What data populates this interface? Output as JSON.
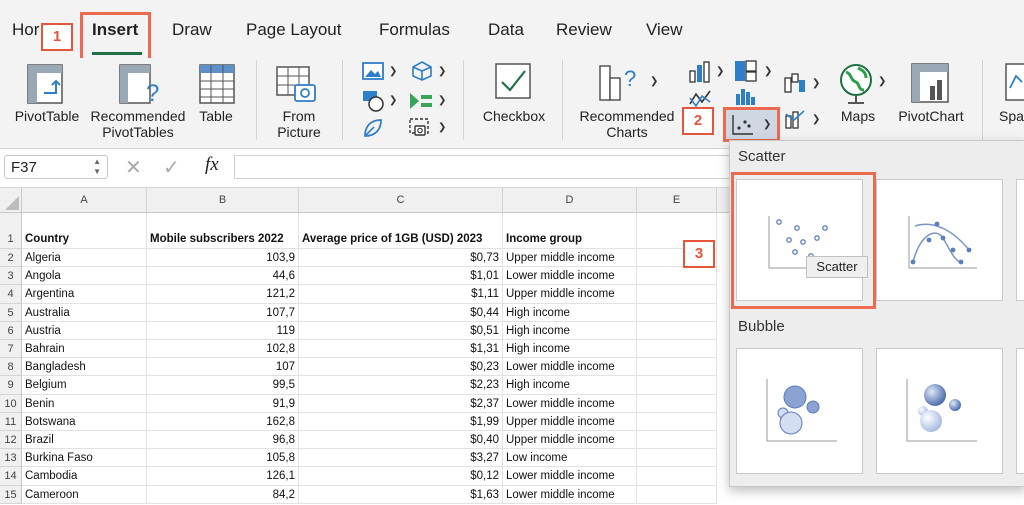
{
  "tabs": [
    {
      "label": "Hor",
      "active": false
    },
    {
      "label": "Insert",
      "active": true
    },
    {
      "label": "Draw",
      "active": false
    },
    {
      "label": "Page Layout",
      "active": false
    },
    {
      "label": "Formulas",
      "active": false
    },
    {
      "label": "Data",
      "active": false
    },
    {
      "label": "Review",
      "active": false
    },
    {
      "label": "View",
      "active": false
    }
  ],
  "ribbon": {
    "pivottable": "PivotTable",
    "recommended_pivottables_1": "Recommended",
    "recommended_pivottables_2": "PivotTables",
    "table": "Table",
    "from_picture_1": "From",
    "from_picture_2": "Picture",
    "checkbox": "Checkbox",
    "recommended_charts_1": "Recommended",
    "recommended_charts_2": "Charts",
    "maps": "Maps",
    "pivotchart": "PivotChart",
    "sparklines_partial": "Spa"
  },
  "formula_bar": {
    "name_box": "F37",
    "fx": "fx",
    "value": ""
  },
  "columns": [
    "A",
    "B",
    "C",
    "D",
    "E"
  ],
  "rows": [
    {
      "n": "1",
      "a": "Country",
      "b": "Mobile subscribers 2022",
      "c": "Average price of 1GB (USD) 2023",
      "d": "Income group"
    },
    {
      "n": "2",
      "a": "Algeria",
      "b": "103,9",
      "c": "$0,73",
      "d": "Upper middle income"
    },
    {
      "n": "3",
      "a": "Angola",
      "b": "44,6",
      "c": "$1,01",
      "d": "Lower middle income"
    },
    {
      "n": "4",
      "a": "Argentina",
      "b": "121,2",
      "c": "$1,11",
      "d": "Upper middle income"
    },
    {
      "n": "5",
      "a": "Australia",
      "b": "107,7",
      "c": "$0,44",
      "d": "High income"
    },
    {
      "n": "6",
      "a": "Austria",
      "b": "119",
      "c": "$0,51",
      "d": "High income"
    },
    {
      "n": "7",
      "a": "Bahrain",
      "b": "102,8",
      "c": "$1,31",
      "d": "High income"
    },
    {
      "n": "8",
      "a": "Bangladesh",
      "b": "107",
      "c": "$0,23",
      "d": "Lower middle income"
    },
    {
      "n": "9",
      "a": "Belgium",
      "b": "99,5",
      "c": "$2,23",
      "d": "High income"
    },
    {
      "n": "10",
      "a": "Benin",
      "b": "91,9",
      "c": "$2,37",
      "d": "Lower middle income"
    },
    {
      "n": "11",
      "a": "Botswana",
      "b": "162,8",
      "c": "$1,99",
      "d": "Upper middle income"
    },
    {
      "n": "12",
      "a": "Brazil",
      "b": "96,8",
      "c": "$0,40",
      "d": "Upper middle income"
    },
    {
      "n": "13",
      "a": "Burkina Faso",
      "b": "105,8",
      "c": "$3,27",
      "d": "Low income"
    },
    {
      "n": "14",
      "a": "Cambodia",
      "b": "126,1",
      "c": "$0,12",
      "d": "Lower middle income"
    },
    {
      "n": "15",
      "a": "Cameroon",
      "b": "84,2",
      "c": "$1,63",
      "d": "Lower middle income"
    }
  ],
  "panel": {
    "scatter_title": "Scatter",
    "bubble_title": "Bubble",
    "tooltip": "Scatter"
  },
  "callouts": [
    "1",
    "2",
    "3"
  ],
  "colors": {
    "accent": "#1e7145",
    "callout": "#e5553b",
    "chart_blue": "#5a7fbf"
  }
}
